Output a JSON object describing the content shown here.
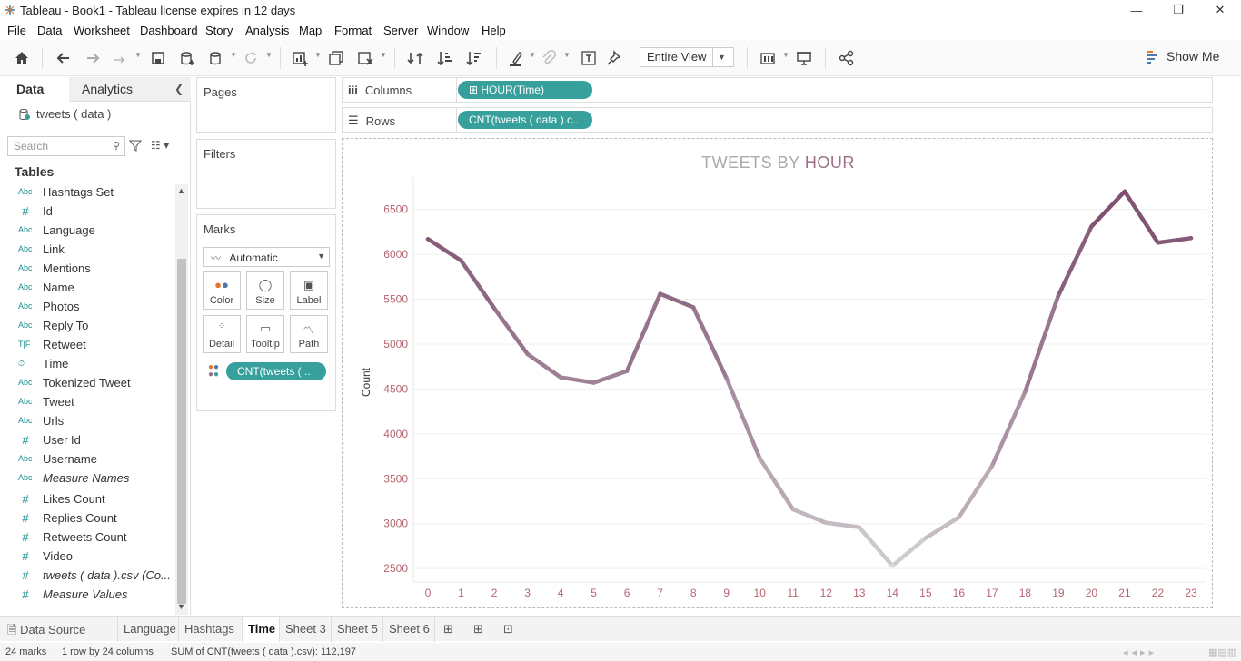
{
  "window": {
    "title": "Tableau - Book1 - Tableau license expires in 12 days",
    "controls": [
      "—",
      "❐",
      "✕"
    ]
  },
  "menu": [
    "File",
    "Data",
    "Worksheet",
    "Dashboard",
    "Story",
    "Analysis",
    "Map",
    "Format",
    "Server",
    "Window",
    "Help"
  ],
  "toolbar": {
    "fit_value": "Entire View",
    "show_me_label": "Show Me"
  },
  "data_pane": {
    "tab_data": "Data",
    "tab_analytics": "Analytics",
    "datasource": "tweets ( data )",
    "search_placeholder": "Search",
    "tables_header": "Tables",
    "fields": [
      {
        "icon": "Abc",
        "type": "group",
        "name": "Hashtags Set"
      },
      {
        "icon": "#",
        "type": "measure",
        "name": "Id"
      },
      {
        "icon": "Abc",
        "type": "string",
        "name": "Language"
      },
      {
        "icon": "Abc",
        "type": "string",
        "name": "Link"
      },
      {
        "icon": "Abc",
        "type": "string",
        "name": "Mentions"
      },
      {
        "icon": "Abc",
        "type": "string",
        "name": "Name"
      },
      {
        "icon": "Abc",
        "type": "string",
        "name": "Photos"
      },
      {
        "icon": "Abc",
        "type": "string",
        "name": "Reply To"
      },
      {
        "icon": "T|F",
        "type": "bool",
        "name": "Retweet"
      },
      {
        "icon": "⏱",
        "type": "date",
        "name": "Time"
      },
      {
        "icon": "Abc",
        "type": "string",
        "name": "Tokenized Tweet"
      },
      {
        "icon": "Abc",
        "type": "string",
        "name": "Tweet"
      },
      {
        "icon": "Abc",
        "type": "string",
        "name": "Urls"
      },
      {
        "icon": "#",
        "type": "measure",
        "name": "User Id"
      },
      {
        "icon": "Abc",
        "type": "string",
        "name": "Username"
      },
      {
        "icon": "Abc",
        "type": "string",
        "name": "Measure Names",
        "italic": true
      }
    ],
    "measures": [
      {
        "icon": "#",
        "name": "Likes Count"
      },
      {
        "icon": "#",
        "name": "Replies Count"
      },
      {
        "icon": "#",
        "name": "Retweets Count"
      },
      {
        "icon": "#",
        "name": "Video"
      },
      {
        "icon": "#",
        "name": "tweets ( data ).csv (Co...",
        "italic": true
      },
      {
        "icon": "#",
        "name": "Measure Values",
        "italic": true
      }
    ]
  },
  "shelves": {
    "pages": "Pages",
    "filters": "Filters",
    "marks": "Marks",
    "mark_type": "Automatic",
    "mark_buttons": [
      "Color",
      "Size",
      "Label",
      "Detail",
      "Tooltip",
      "Path"
    ],
    "marks_pill": "CNT(tweets ( ..",
    "columns_label": "Columns",
    "columns_pill": "HOUR(Time)",
    "rows_label": "Rows",
    "rows_pill": "CNT(tweets ( data ).c.."
  },
  "chart_data": {
    "type": "line",
    "title_part1": "TWEETS BY ",
    "title_part2": "HOUR",
    "ylabel": "Count",
    "xlabel": "",
    "x": [
      0,
      1,
      2,
      3,
      4,
      5,
      6,
      7,
      8,
      9,
      10,
      11,
      12,
      13,
      14,
      15,
      16,
      17,
      18,
      19,
      20,
      21,
      22,
      23
    ],
    "values": [
      6170,
      5930,
      5400,
      4890,
      4630,
      4570,
      4700,
      5560,
      5410,
      4620,
      3730,
      3160,
      3010,
      2960,
      2530,
      2840,
      3070,
      3640,
      4470,
      5540,
      6310,
      6700,
      6130,
      6180
    ],
    "y_ticks": [
      2500,
      3000,
      3500,
      4000,
      4500,
      5000,
      5500,
      6000,
      6500
    ],
    "ylim": [
      2350,
      6800
    ],
    "grid": true,
    "color_high": "#7d4d6e",
    "color_low": "#d8d8d8"
  },
  "bottom_tabs": [
    "Data Source",
    "Language",
    "Hashtags",
    "Time",
    "Sheet 3",
    "Sheet 5",
    "Sheet 6"
  ],
  "active_tab": "Time",
  "status": {
    "marks": "24 marks",
    "rows_cols": "1 row by 24 columns",
    "sum": "SUM of CNT(tweets ( data ).csv): 112,197"
  }
}
